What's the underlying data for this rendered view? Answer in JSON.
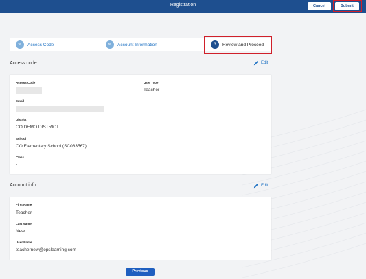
{
  "header": {
    "title": "Registration",
    "cancel_label": "Cancel",
    "submit_label": "Submit"
  },
  "stepper": {
    "steps": [
      {
        "label": "Access Code",
        "state": "complete",
        "marker": "✎"
      },
      {
        "label": "Account Information",
        "state": "complete",
        "marker": "✎"
      },
      {
        "label": "Review and Proceed",
        "state": "active",
        "marker": "3"
      }
    ]
  },
  "access_code_section": {
    "title": "Access code",
    "edit_label": "Edit",
    "fields": {
      "access_code_label": "Access Code",
      "user_type_label": "User Type",
      "user_type_value": "Teacher",
      "email_label": "Email",
      "district_label": "District",
      "district_value": "CO DEMO DISTRICT",
      "school_label": "School",
      "school_value": "CO Elementary School (SC083567)",
      "class_label": "Class",
      "class_value": "-"
    }
  },
  "account_info_section": {
    "title": "Account info",
    "edit_label": "Edit",
    "fields": {
      "first_name_label": "First Name",
      "first_name_value": "Teacher",
      "last_name_label": "Last Name",
      "last_name_value": "New",
      "user_name_label": "User Name",
      "user_name_value": "teachernew@epslearning.com"
    }
  },
  "footer": {
    "previous_label": "Previous"
  },
  "colors": {
    "header_bg": "#1e4f8f",
    "highlight": "#d0202a",
    "link": "#1f72c3",
    "primary_button": "#1f5fc0"
  }
}
